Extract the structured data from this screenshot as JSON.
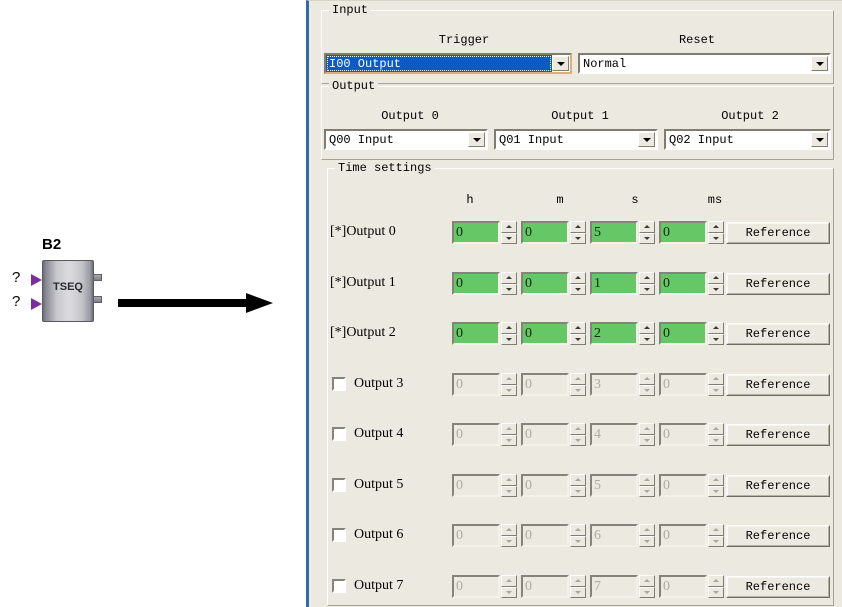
{
  "diagram": {
    "block_label": "B2",
    "block_type": "TSEQ",
    "input_marks": [
      "?",
      "?"
    ],
    "arrow": "right-arrow"
  },
  "panel": {
    "input_group": {
      "title": "Input",
      "trigger": {
        "caption": "Trigger",
        "value": "I00  Output",
        "focused": true
      },
      "reset": {
        "caption": "Reset",
        "value": "Normal",
        "focused": false
      }
    },
    "output_group": {
      "title": "Output",
      "fields": [
        {
          "caption": "Output 0",
          "value": "Q00  Input"
        },
        {
          "caption": "Output 1",
          "value": "Q01  Input"
        },
        {
          "caption": "Output 2",
          "value": "Q02  Input"
        }
      ]
    },
    "time_group": {
      "title": "Time settings",
      "columns": [
        "h",
        "m",
        "s",
        "ms"
      ],
      "reference_label": "Reference",
      "rows": [
        {
          "label": "[*]Output 0",
          "checkbox": false,
          "enabled": true,
          "h": "0",
          "m": "0",
          "s": "5",
          "ms": "0"
        },
        {
          "label": "[*]Output 1",
          "checkbox": false,
          "enabled": true,
          "h": "0",
          "m": "0",
          "s": "1",
          "ms": "0"
        },
        {
          "label": "[*]Output 2",
          "checkbox": false,
          "enabled": true,
          "h": "0",
          "m": "0",
          "s": "2",
          "ms": "0"
        },
        {
          "label": "Output 3",
          "checkbox": true,
          "enabled": false,
          "h": "0",
          "m": "0",
          "s": "3",
          "ms": "0"
        },
        {
          "label": "Output 4",
          "checkbox": true,
          "enabled": false,
          "h": "0",
          "m": "0",
          "s": "4",
          "ms": "0"
        },
        {
          "label": "Output 5",
          "checkbox": true,
          "enabled": false,
          "h": "0",
          "m": "0",
          "s": "5",
          "ms": "0"
        },
        {
          "label": "Output 6",
          "checkbox": true,
          "enabled": false,
          "h": "0",
          "m": "0",
          "s": "6",
          "ms": "0"
        },
        {
          "label": "Output 7",
          "checkbox": true,
          "enabled": false,
          "h": "0",
          "m": "0",
          "s": "7",
          "ms": "0"
        }
      ]
    }
  },
  "colors": {
    "dialog_face": "#ece9e0",
    "active_field_green": "#66c766",
    "selection_blue": "#0a5bc4",
    "panel_border": "#2f6d9e",
    "pin_purple": "#7b2f9e"
  }
}
